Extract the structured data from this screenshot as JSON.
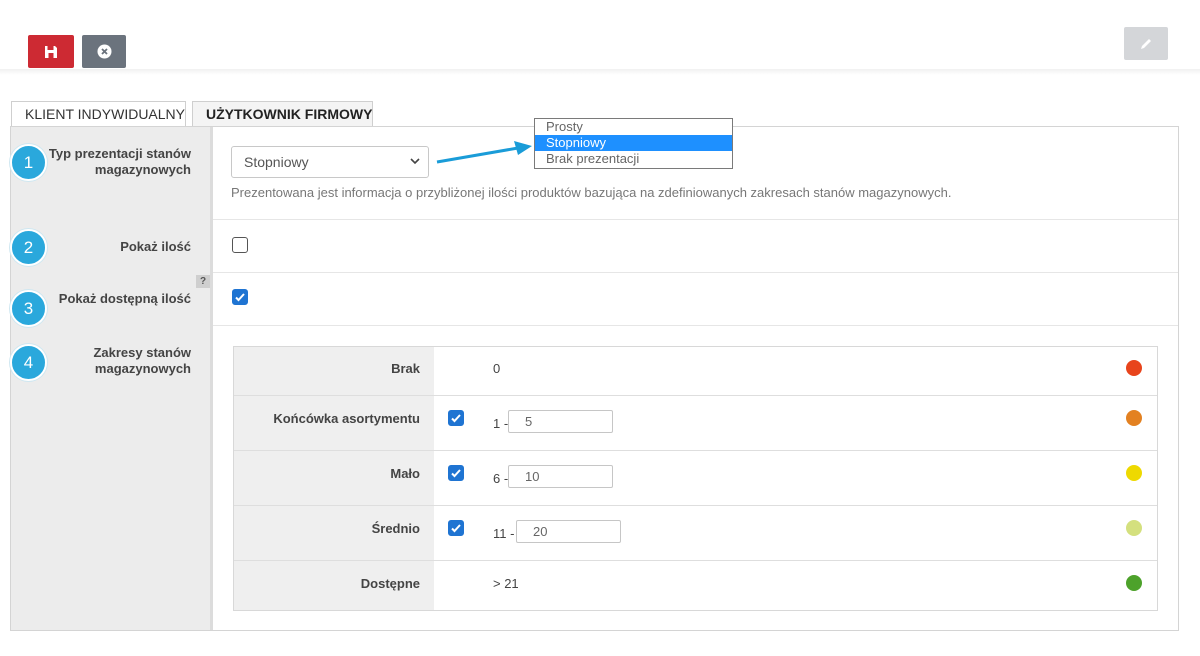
{
  "toolbar": {
    "save_icon": "floppy-disk-icon",
    "cancel_icon": "close-circle-icon",
    "edit_icon": "pencil-icon"
  },
  "tabs": [
    {
      "label": "KLIENT INDYWIDUALNY",
      "active": false
    },
    {
      "label": "UŻYTKOWNIK FIRMOWY",
      "active": true
    }
  ],
  "fields": {
    "presentation_type": {
      "number": "1",
      "label": "Typ prezentacji stanów magazynowych",
      "value": "Stopniowy",
      "description": "Prezentowana jest informacja o przybliżonej ilości produktów bazująca na zdefiniowanych zakresach stanów magazynowych.",
      "options": [
        "Prosty",
        "Stopniowy",
        "Brak prezentacji"
      ],
      "selected_option": "Stopniowy"
    },
    "show_quantity": {
      "number": "2",
      "label": "Pokaż ilość",
      "checked": false
    },
    "show_available": {
      "number": "3",
      "label": "Pokaż dostępną ilość",
      "checked": true,
      "help": "?"
    },
    "ranges": {
      "number": "4",
      "label": "Zakresy stanów magazynowych"
    }
  },
  "ranges": [
    {
      "name": "Brak",
      "value": "0",
      "color": "#e8441c"
    },
    {
      "name": "Końcówka asortymentu",
      "checked": true,
      "from": "1 -",
      "to": "5",
      "color": "#e38121"
    },
    {
      "name": "Mało",
      "checked": true,
      "from": "6 -",
      "to": "10",
      "color": "#eed900"
    },
    {
      "name": "Średnio",
      "checked": true,
      "from": "11 -",
      "to": "20",
      "color": "#d4e07e"
    },
    {
      "name": "Dostępne",
      "value": "> 21",
      "color": "#4da22b"
    }
  ],
  "colors": {
    "accent_red": "#cd2a33",
    "step_badge": "#2aa8dc",
    "checkbox": "#1f74d2",
    "dropdown_highlight": "#1e90ff"
  }
}
